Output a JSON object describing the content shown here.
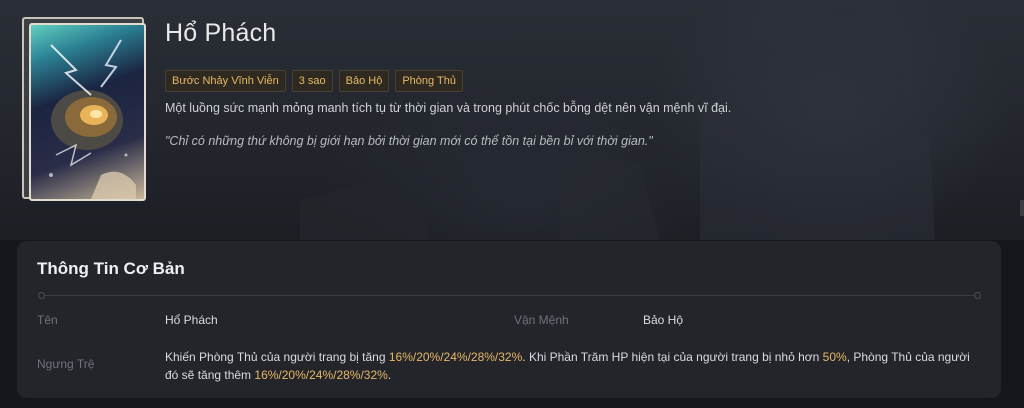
{
  "item": {
    "name": "Hổ Phách",
    "tags": [
      "Bước Nhảy Vĩnh Viễn",
      "3 sao",
      "Bảo Hộ",
      "Phòng Thủ"
    ],
    "description": "Một luồng sức mạnh mỏng manh tích tụ từ thời gian và trong phút chốc bỗng dệt nên vận mệnh vĩ đại.",
    "quote": "\"Chỉ có những thứ không bị giới hạn bởi thời gian mới có thể tồn tại bền bỉ với thời gian.\""
  },
  "basic_info": {
    "title": "Thông Tin Cơ Bản",
    "name_label": "Tên",
    "name_value": "Hổ Phách",
    "destiny_label": "Vận Mệnh",
    "destiny_value": "Bảo Hộ",
    "effect_label": "Ngưng Trệ",
    "effect_parts": {
      "p1": "Khiến Phòng Thủ của người trang bị tăng ",
      "v1": "16%/20%/24%/28%/32%",
      "p2": ". Khi Phần Trăm HP hiện tại của người trang bị nhỏ hơn ",
      "v2": "50%",
      "p3": ", Phòng Thủ của người đó sẽ tăng thêm ",
      "v3": "16%/20%/24%/28%/32%",
      "p4": "."
    }
  },
  "icons": {
    "card_art": "amber-light-cone-card-icon"
  },
  "colors": {
    "accent": "#e8b865",
    "panel": "#23252b",
    "background": "#15171c"
  }
}
